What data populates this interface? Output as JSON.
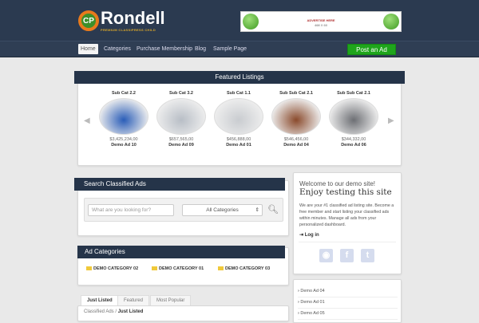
{
  "header": {
    "logo_mark": "CP",
    "logo_title": "Rondell",
    "logo_subtitle": "PREMIUM CLASSIPRESS CHILD",
    "banner_line1": "ADVERTISE HERE",
    "banner_line2": "468 X 60"
  },
  "nav": {
    "items": [
      "Home",
      "Categories",
      "Purchase Membership",
      "Blog",
      "Sample Page"
    ],
    "post_button": "Post an Ad"
  },
  "featured": {
    "title": "Featured Listings",
    "items": [
      {
        "category": "Sub Cat 2.2",
        "price": "$3,425,234,00",
        "name": "Demo Ad 10",
        "color": "#2a5db8"
      },
      {
        "category": "Sub Cat 3.2",
        "price": "$657,565,00",
        "name": "Demo Ad 09",
        "color": "#b8bec6"
      },
      {
        "category": "Sub Cat 1.1",
        "price": "$456,888,00",
        "name": "Demo Ad 01",
        "color": "#c9ccd0"
      },
      {
        "category": "Sub Sub Cat 2.1",
        "price": "$546,456,00",
        "name": "Demo Ad 04",
        "color": "#8a4a2c"
      },
      {
        "category": "Sub Sub Cat 2.1",
        "price": "$344,332,00",
        "name": "Demo Ad 06",
        "color": "#6d6f74"
      }
    ]
  },
  "search": {
    "title": "Search Classified Ads",
    "placeholder": "What are you looking for?",
    "category_select": "All Categories"
  },
  "categories": {
    "title": "Ad Categories",
    "items": [
      "DEMO CATEGORY 02",
      "DEMO CATEGORY 01",
      "DEMO CATEGORY 03"
    ]
  },
  "tabs": {
    "items": [
      "Just Listed",
      "Featured",
      "Most Popular"
    ],
    "breadcrumb_root": "Classified Ads",
    "breadcrumb_sep": " / ",
    "breadcrumb_current": "Just Listed"
  },
  "sidebar": {
    "welcome": "Welcome to our demo site!",
    "heading": "Enjoy testing this site",
    "body": "We are your #1 classified ad listing site. Become a free member and start listing your classified ads within minutes. Manage all ads from your personalized dashboard.",
    "login": "Log in",
    "recent": [
      "Demo Ad 04",
      "Demo Ad 01",
      "Demo Ad 05"
    ]
  }
}
